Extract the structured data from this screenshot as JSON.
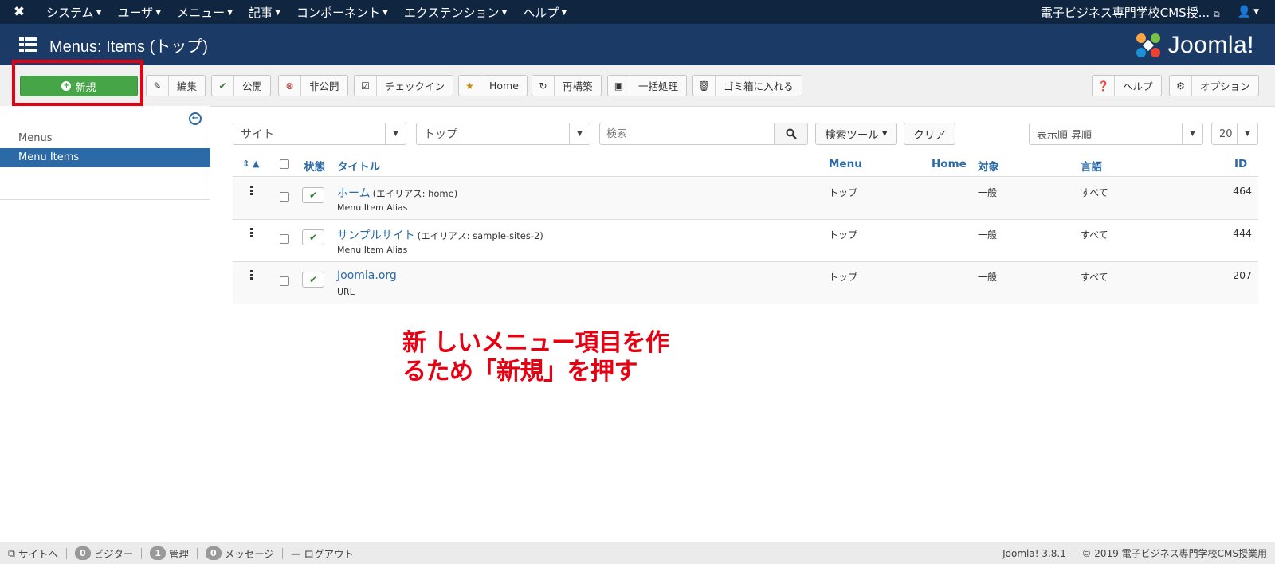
{
  "topnav": {
    "menus": [
      "システム",
      "ユーザ",
      "メニュー",
      "記事",
      "コンポーネント",
      "エクステンション",
      "ヘルプ"
    ],
    "site_name": "電子ビジネス専門学校CMS授..."
  },
  "header": {
    "title": "Menus: Items (トップ)",
    "brand": "Joomla!"
  },
  "toolbar": {
    "new": "新規",
    "edit": "編集",
    "publish": "公開",
    "unpublish": "非公開",
    "checkin": "チェックイン",
    "home": "Home",
    "rebuild": "再構築",
    "batch": "一括処理",
    "trash": "ゴミ箱に入れる",
    "help": "ヘルプ",
    "options": "オプション"
  },
  "sidebar": {
    "items": [
      {
        "label": "Menus",
        "active": false
      },
      {
        "label": "Menu Items",
        "active": true
      }
    ]
  },
  "filters": {
    "client": "サイト",
    "menu": "トップ",
    "search_placeholder": "検索",
    "search_tools": "検索ツール",
    "clear": "クリア",
    "ordering": "表示順 昇順",
    "limit": "20"
  },
  "table": {
    "headers": {
      "status": "状態",
      "title": "タイトル",
      "menu": "Menu",
      "home": "Home",
      "access": "対象",
      "language": "言語",
      "id": "ID"
    },
    "rows": [
      {
        "title": "ホーム",
        "alias": "(エイリアス: home)",
        "type": "Menu Item Alias",
        "menu": "トップ",
        "access": "一般",
        "language": "すべて",
        "id": "464"
      },
      {
        "title": "サンプルサイト",
        "alias": "(エイリアス: sample-sites-2)",
        "type": "Menu Item Alias",
        "menu": "トップ",
        "access": "一般",
        "language": "すべて",
        "id": "444"
      },
      {
        "title": "Joomla.org",
        "alias": "",
        "type": "URL",
        "menu": "トップ",
        "access": "一般",
        "language": "すべて",
        "id": "207"
      }
    ]
  },
  "annotation": {
    "line1": "新 しいメニュー項目を作",
    "line2": "るため「新規」を押す"
  },
  "footer": {
    "view_site": "サイトへ",
    "visitors_count": "0",
    "visitors": "ビジター",
    "admins_count": "1",
    "admins": "管理",
    "messages_count": "0",
    "messages": "メッセージ",
    "logout": "ログアウト",
    "version": "Joomla! 3.8.1 — © 2019 電子ビジネス専門学校CMS授業用"
  },
  "colors": {
    "topnav_bg": "#0f2540",
    "header_bg": "#1b3a66",
    "new_button": "#46a546",
    "link": "#2c6aa7",
    "highlight": "#e60012"
  }
}
